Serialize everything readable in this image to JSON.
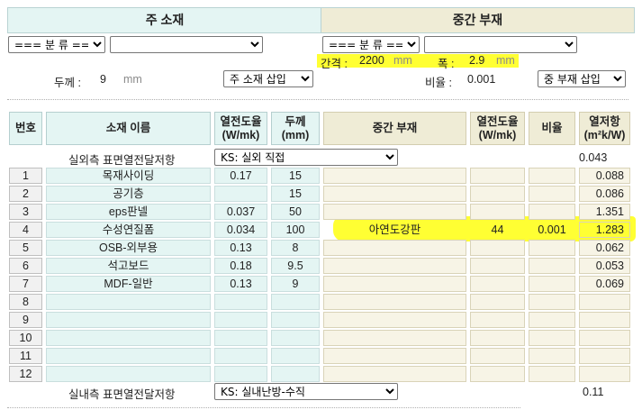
{
  "headers": {
    "main_material": "주 소재",
    "mid_member": "중간 부재"
  },
  "main_select": {
    "category": "=== 분 류 ===",
    "item": ""
  },
  "mid_select": {
    "category": "=== 분 류 ===",
    "item": ""
  },
  "spacing": {
    "label": "간격 :",
    "value": "2200",
    "unit": "mm"
  },
  "width": {
    "label": "폭 :",
    "value": "2.9",
    "unit": "mm"
  },
  "thickness": {
    "label": "두께 :",
    "value": "9",
    "unit": "mm"
  },
  "insert_main": "주 소재 삽입",
  "ratio": {
    "label": "비율 :",
    "value": "0.001"
  },
  "insert_mid": "중 부재 삽입",
  "table_headers": {
    "no": "번호",
    "name": "소재 이름",
    "conductivity": "열전도율",
    "conductivity_unit": "(W/mk)",
    "thickness": "두께",
    "thickness_unit": "(mm)",
    "mid_member": "중간 부재",
    "mid_conductivity": "열전도율",
    "mid_conductivity_unit": "(W/mk)",
    "ratio": "비율",
    "resistance": "열저항",
    "resistance_unit": "(m²k/W)"
  },
  "outside_surface": {
    "label": "실외측 표면열전달저항",
    "select": "KS: 실외 직접",
    "value": "0.043"
  },
  "inside_surface": {
    "label": "실내측 표면열전달저항",
    "select": "KS: 실내난방-수직",
    "value": "0.11"
  },
  "rows": [
    {
      "no": "1",
      "name": "목재사이딩",
      "k": "0.17",
      "t": "15",
      "mid": "",
      "mk": "",
      "ratio": "",
      "r": "0.088"
    },
    {
      "no": "2",
      "name": "공기층",
      "k": "",
      "t": "15",
      "mid": "",
      "mk": "",
      "ratio": "",
      "r": "0.086"
    },
    {
      "no": "3",
      "name": "eps판넬",
      "k": "0.037",
      "t": "50",
      "mid": "",
      "mk": "",
      "ratio": "",
      "r": "1.351"
    },
    {
      "no": "4",
      "name": "수성연질폼",
      "k": "0.034",
      "t": "100",
      "mid": "아연도강판",
      "mk": "44",
      "ratio": "0.001",
      "r": "1.283"
    },
    {
      "no": "5",
      "name": "OSB-외부용",
      "k": "0.13",
      "t": "8",
      "mid": "",
      "mk": "",
      "ratio": "",
      "r": "0.062"
    },
    {
      "no": "6",
      "name": "석고보드",
      "k": "0.18",
      "t": "9.5",
      "mid": "",
      "mk": "",
      "ratio": "",
      "r": "0.053"
    },
    {
      "no": "7",
      "name": "MDF-일반",
      "k": "0.13",
      "t": "9",
      "mid": "",
      "mk": "",
      "ratio": "",
      "r": "0.069"
    },
    {
      "no": "8",
      "name": "",
      "k": "",
      "t": "",
      "mid": "",
      "mk": "",
      "ratio": "",
      "r": ""
    },
    {
      "no": "9",
      "name": "",
      "k": "",
      "t": "",
      "mid": "",
      "mk": "",
      "ratio": "",
      "r": ""
    },
    {
      "no": "10",
      "name": "",
      "k": "",
      "t": "",
      "mid": "",
      "mk": "",
      "ratio": "",
      "r": ""
    },
    {
      "no": "11",
      "name": "",
      "k": "",
      "t": "",
      "mid": "",
      "mk": "",
      "ratio": "",
      "r": ""
    },
    {
      "no": "12",
      "name": "",
      "k": "",
      "t": "",
      "mid": "",
      "mk": "",
      "ratio": "",
      "r": ""
    }
  ],
  "colors": {
    "highlight": "#ffff33",
    "teal_panel": "#e4f5f3",
    "beige_panel": "#efecd6"
  }
}
